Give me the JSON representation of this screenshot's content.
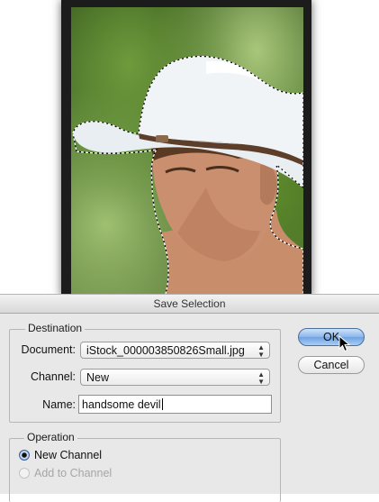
{
  "dialog": {
    "title": "Save Selection",
    "destination": {
      "group_label": "Destination",
      "document_label": "Document:",
      "document_value": "iStock_000003850826Small.jpg",
      "channel_label": "Channel:",
      "channel_value": "New",
      "name_label": "Name:",
      "name_value": "handsome devil"
    },
    "operation": {
      "group_label": "Operation",
      "options": [
        {
          "label": "New Channel",
          "selected": true,
          "enabled": true
        },
        {
          "label": "Add to Channel",
          "selected": false,
          "enabled": false
        }
      ]
    },
    "buttons": {
      "ok_label": "OK",
      "cancel_label": "Cancel"
    }
  },
  "icons": {
    "select_arrows": "select-arrows-icon",
    "cursor": "mouse-pointer-icon"
  },
  "colors": {
    "default_button": "#7aa8e3",
    "dialog_bg": "#e8e8e8"
  }
}
